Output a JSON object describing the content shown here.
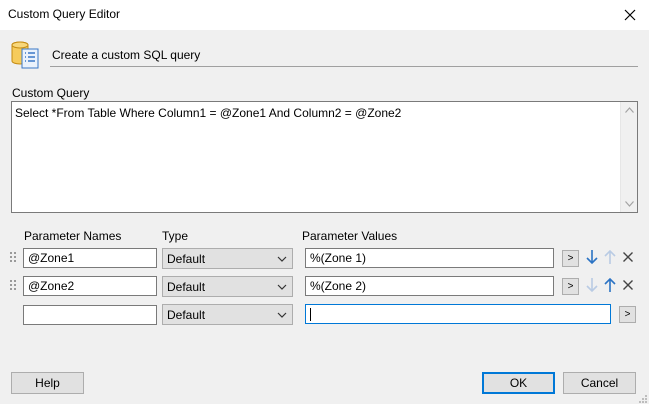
{
  "window": {
    "title": "Custom Query Editor"
  },
  "header": {
    "text": "Create a custom SQL query"
  },
  "query": {
    "label": "Custom Query",
    "value": "Select *From Table Where Column1 = @Zone1 And Column2 = @Zone2"
  },
  "parameters": {
    "headers": {
      "names": "Parameter Names",
      "type": "Type",
      "values": "Parameter Values"
    },
    "rows": [
      {
        "name": "@Zone1",
        "type": "Default",
        "value": "%(Zone 1)",
        "picker": ">"
      },
      {
        "name": "@Zone2",
        "type": "Default",
        "value": "%(Zone 2)",
        "picker": ">"
      },
      {
        "name": "",
        "type": "Default",
        "value": "",
        "picker": ">"
      }
    ]
  },
  "buttons": {
    "help": "Help",
    "ok": "OK",
    "cancel": "Cancel"
  },
  "colors": {
    "accent": "#0078d7",
    "arrow_active": "#2b73c4",
    "arrow_disabled": "#b9cbe4"
  }
}
